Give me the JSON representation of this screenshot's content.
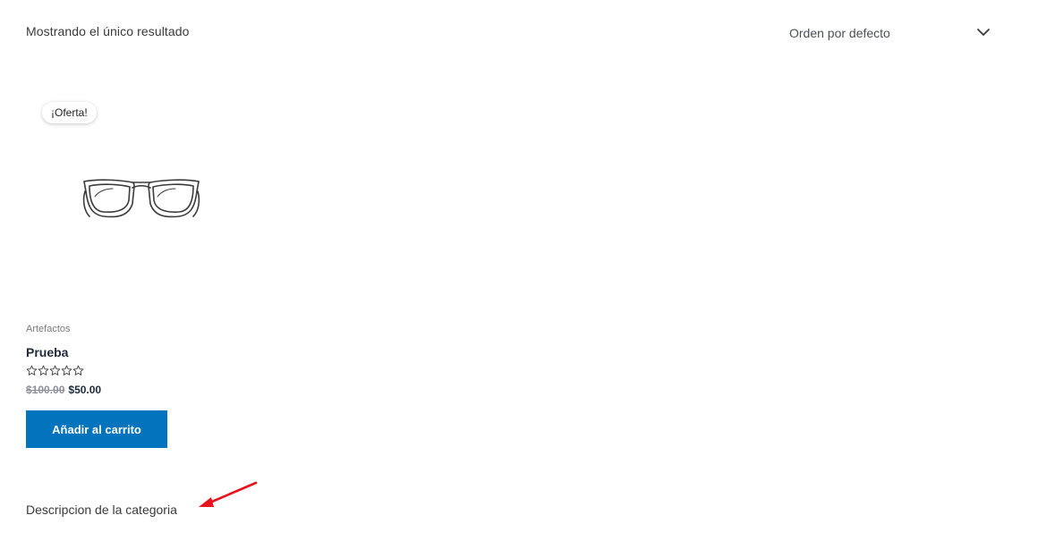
{
  "shop": {
    "result_count": "Mostrando el único resultado",
    "ordering": {
      "selected": "Orden por defecto",
      "icon": "chevron-down-icon"
    }
  },
  "product": {
    "badge": "¡Oferta!",
    "image_icon": "eyeglasses-icon",
    "category": "Artefactos",
    "title": "Prueba",
    "rating": {
      "value": 0,
      "max": 5
    },
    "price_old": "$100.00",
    "price_new": "$50.00",
    "add_to_cart_label": "Añadir al carrito"
  },
  "category_description": "Descripcion de la categoria",
  "annotation": {
    "icon": "red-arrow-icon",
    "color": "#e8141c"
  },
  "colors": {
    "button": "#0274be",
    "text": "#3a3a3a",
    "muted": "#7a7a7a"
  }
}
